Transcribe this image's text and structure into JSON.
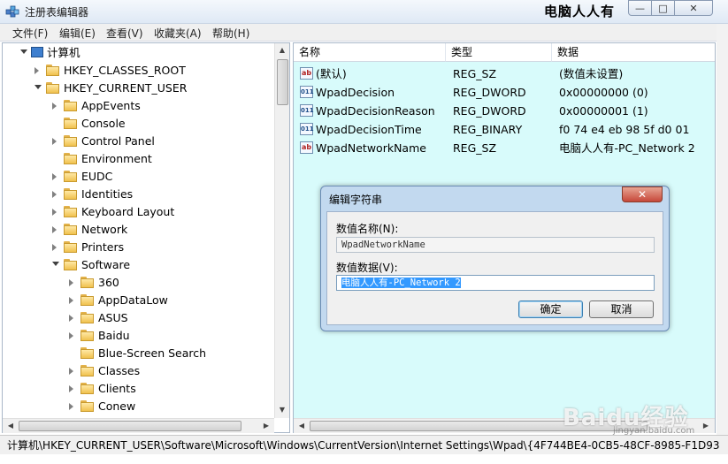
{
  "window": {
    "title": "注册表编辑器",
    "watermark_top": "电脑人人有",
    "buttons": {
      "minimize": "—",
      "maximize": "□",
      "close": "✕"
    }
  },
  "menu": [
    "文件(F)",
    "编辑(E)",
    "查看(V)",
    "收藏夹(A)",
    "帮助(H)"
  ],
  "tree": {
    "root": "计算机",
    "items": [
      {
        "label": "HKEY_CLASSES_ROOT",
        "level": 1,
        "expander": "closed"
      },
      {
        "label": "HKEY_CURRENT_USER",
        "level": 1,
        "expander": "open"
      },
      {
        "label": "AppEvents",
        "level": 2,
        "expander": "closed"
      },
      {
        "label": "Console",
        "level": 2,
        "expander": "none"
      },
      {
        "label": "Control Panel",
        "level": 2,
        "expander": "closed"
      },
      {
        "label": "Environment",
        "level": 2,
        "expander": "none"
      },
      {
        "label": "EUDC",
        "level": 2,
        "expander": "closed"
      },
      {
        "label": "Identities",
        "level": 2,
        "expander": "closed"
      },
      {
        "label": "Keyboard Layout",
        "level": 2,
        "expander": "closed"
      },
      {
        "label": "Network",
        "level": 2,
        "expander": "closed"
      },
      {
        "label": "Printers",
        "level": 2,
        "expander": "closed"
      },
      {
        "label": "Software",
        "level": 2,
        "expander": "open"
      },
      {
        "label": "360",
        "level": 3,
        "expander": "closed"
      },
      {
        "label": "AppDataLow",
        "level": 3,
        "expander": "closed"
      },
      {
        "label": "ASUS",
        "level": 3,
        "expander": "closed"
      },
      {
        "label": "Baidu",
        "level": 3,
        "expander": "closed"
      },
      {
        "label": "Blue-Screen Search",
        "level": 3,
        "expander": "none"
      },
      {
        "label": "Classes",
        "level": 3,
        "expander": "closed"
      },
      {
        "label": "Clients",
        "level": 3,
        "expander": "closed"
      },
      {
        "label": "Conew",
        "level": 3,
        "expander": "closed"
      }
    ]
  },
  "list": {
    "columns": [
      "名称",
      "类型",
      "数据"
    ],
    "rows": [
      {
        "name": "(默认)",
        "type": "REG_SZ",
        "data": "(数值未设置)",
        "icon": "string-value-icon"
      },
      {
        "name": "WpadDecision",
        "type": "REG_DWORD",
        "data": "0x00000000 (0)",
        "icon": "binary-value-icon"
      },
      {
        "name": "WpadDecisionReason",
        "type": "REG_DWORD",
        "data": "0x00000001 (1)",
        "icon": "binary-value-icon"
      },
      {
        "name": "WpadDecisionTime",
        "type": "REG_BINARY",
        "data": "f0 74 e4 eb 98 5f d0 01",
        "icon": "binary-value-icon"
      },
      {
        "name": "WpadNetworkName",
        "type": "REG_SZ",
        "data": "电脑人人有-PC_Network  2",
        "icon": "string-value-icon"
      }
    ]
  },
  "status": "计算机\\HKEY_CURRENT_USER\\Software\\Microsoft\\Windows\\CurrentVersion\\Internet Settings\\Wpad\\{4F744BE4-0CB5-48CF-8985-F1D93",
  "dialog": {
    "title": "编辑字符串",
    "close": "✕",
    "name_label": "数值名称(N):",
    "name_value": "WpadNetworkName",
    "data_label": "数值数据(V):",
    "data_value": "电脑人人有-PC_Network  2",
    "ok": "确定",
    "cancel": "取消"
  },
  "watermark": {
    "text": "Baidu经验",
    "sub": "jingyan.baidu.com"
  }
}
